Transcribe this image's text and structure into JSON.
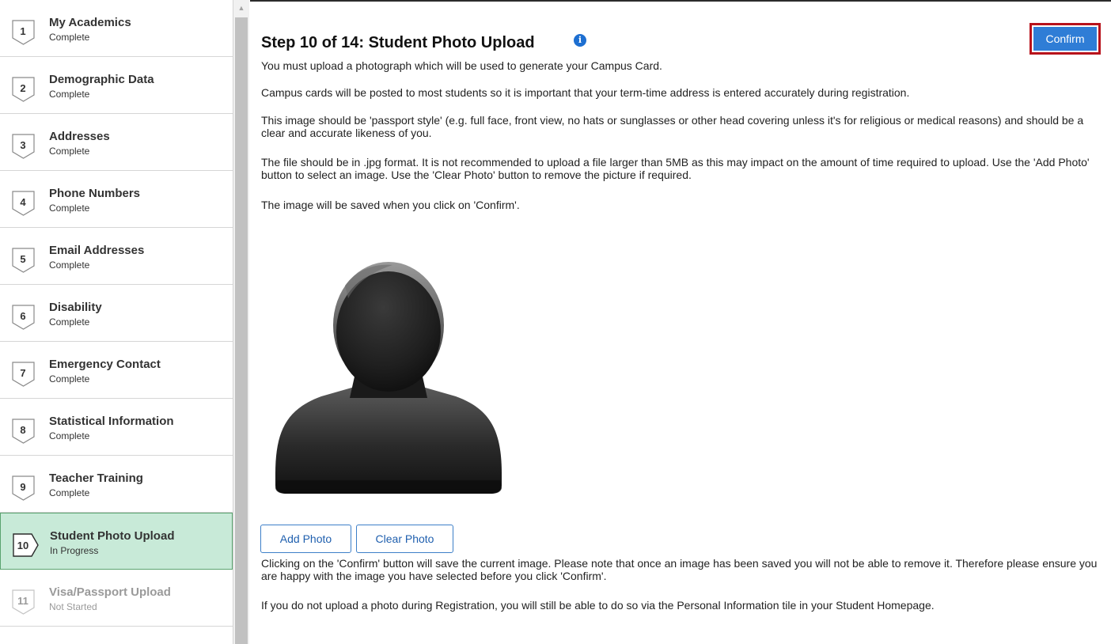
{
  "sidebar": {
    "steps": [
      {
        "num": "1",
        "title": "My Academics",
        "status": "Complete"
      },
      {
        "num": "2",
        "title": "Demographic Data",
        "status": "Complete"
      },
      {
        "num": "3",
        "title": "Addresses",
        "status": "Complete"
      },
      {
        "num": "4",
        "title": "Phone Numbers",
        "status": "Complete"
      },
      {
        "num": "5",
        "title": "Email Addresses",
        "status": "Complete"
      },
      {
        "num": "6",
        "title": "Disability",
        "status": "Complete"
      },
      {
        "num": "7",
        "title": "Emergency Contact",
        "status": "Complete"
      },
      {
        "num": "8",
        "title": "Statistical Information",
        "status": "Complete"
      },
      {
        "num": "9",
        "title": "Teacher Training",
        "status": "Complete"
      },
      {
        "num": "10",
        "title": "Student Photo Upload",
        "status": "In Progress"
      },
      {
        "num": "11",
        "title": "Visa/Passport Upload",
        "status": "Not Started"
      }
    ]
  },
  "main": {
    "title": "Step 10 of 14: Student Photo Upload",
    "confirm_label": "Confirm",
    "info_icon": "i",
    "paragraphs": {
      "p1": "You must upload a photograph which will be used to generate your Campus Card.",
      "p2": "Campus cards will be posted to most students so it is important that your term-time address is entered accurately during registration.",
      "p3": "This image should be 'passport style' (e.g. full face, front view, no hats or sunglasses or other head covering unless it's for religious or medical reasons) and should be a clear and accurate likeness of you.",
      "p4": "The file should be in .jpg format. It is not recommended to upload a file larger than 5MB as this may impact on the amount of time required to upload. Use the 'Add Photo' button to select an image. Use the 'Clear Photo' button to remove the picture if required.",
      "p5": "The image will be saved when you click on 'Confirm'.",
      "p6": "Clicking on the 'Confirm' button will save the current image. Please note that once an image has been saved you will not be able to remove it. Therefore please ensure you are happy with the image you have selected before you click 'Confirm'.",
      "p7": "If you do not upload a photo during Registration, you will still be able to do so via the Personal Information tile in your Student Homepage."
    },
    "add_photo_label": "Add Photo",
    "clear_photo_label": "Clear Photo"
  },
  "colors": {
    "accent": "#2f7dd6",
    "highlight_border": "#b8121b",
    "active_step_bg": "#c8ead8"
  }
}
